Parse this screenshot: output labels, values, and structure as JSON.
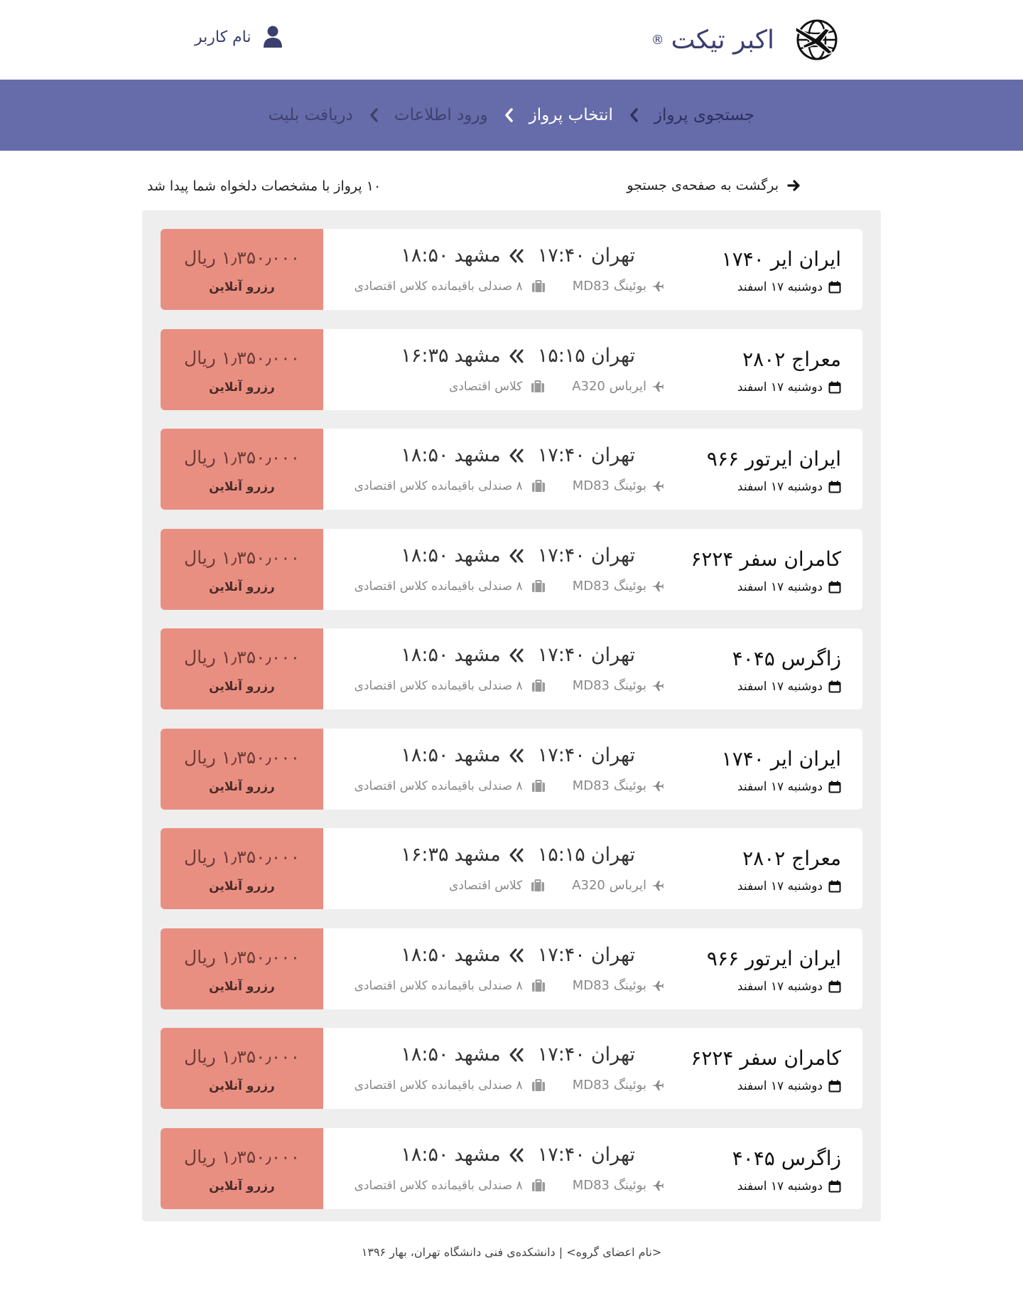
{
  "header": {
    "brand": "اکبر تیکت",
    "registered_mark": "®",
    "user_name": "نام کاربر",
    "logo_icon": "globe-plane-icon",
    "user_icon": "user-icon"
  },
  "steps": [
    {
      "label": "جستجوی پرواز",
      "state": "done"
    },
    {
      "label": "انتخاب پرواز",
      "state": "active"
    },
    {
      "label": "ورود اطلاعات",
      "state": "future"
    },
    {
      "label": "دریافت بلیت",
      "state": "future"
    }
  ],
  "results": {
    "back_label": "برگشت به صفحه‌ی جستجو",
    "count_label": "۱۰ پرواز با مشخصات  دلخواه شما پیدا شد"
  },
  "colors": {
    "steps_bar": "#666ba9",
    "price_box": "#e98f82",
    "list_bg": "#eeeeee",
    "brand_text": "#3b3f6e"
  },
  "flights": [
    {
      "airline": "ایران ایر ۱۷۴۰",
      "date": "دوشنبه ۱۷ اسفند",
      "origin": "تهران",
      "departure": "۱۷:۴۰",
      "destination": "مشهد",
      "arrival": "۱۸:۵۰",
      "aircraft": "بوئینگ MD83",
      "seats": "۸ صندلی باقیمانده کلاس اقتصادی",
      "price": "۱٫۳۵۰٫۰۰۰ ریال",
      "book": "رزرو آنلاین"
    },
    {
      "airline": "معراج ۲۸۰۲",
      "date": "دوشنبه ۱۷ اسفند",
      "origin": "تهران",
      "departure": "۱۵:۱۵",
      "destination": "مشهد",
      "arrival": "۱۶:۳۵",
      "aircraft": "ایرباس A320",
      "seats": "کلاس اقتصادی",
      "price": "۱٫۳۵۰٫۰۰۰ ریال",
      "book": "رزرو آنلاین"
    },
    {
      "airline": "ایران ایرتور ۹۶۶",
      "date": "دوشنبه ۱۷ اسفند",
      "origin": "تهران",
      "departure": "۱۷:۴۰",
      "destination": "مشهد",
      "arrival": "۱۸:۵۰",
      "aircraft": "بوئینگ MD83",
      "seats": "۸ صندلی باقیمانده کلاس اقتصادی",
      "price": "۱٫۳۵۰٫۰۰۰ ریال",
      "book": "رزرو آنلاین"
    },
    {
      "airline": "کامران سفر ۶۲۲۴",
      "date": "دوشنبه ۱۷ اسفند",
      "origin": "تهران",
      "departure": "۱۷:۴۰",
      "destination": "مشهد",
      "arrival": "۱۸:۵۰",
      "aircraft": "بوئینگ MD83",
      "seats": "۸ صندلی باقیمانده کلاس اقتصادی",
      "price": "۱٫۳۵۰٫۰۰۰ ریال",
      "book": "رزرو آنلاین"
    },
    {
      "airline": "زاگرس ۴۰۴۵",
      "date": "دوشنبه ۱۷ اسفند",
      "origin": "تهران",
      "departure": "۱۷:۴۰",
      "destination": "مشهد",
      "arrival": "۱۸:۵۰",
      "aircraft": "بوئینگ MD83",
      "seats": "۸ صندلی باقیمانده کلاس اقتصادی",
      "price": "۱٫۳۵۰٫۰۰۰ ریال",
      "book": "رزرو آنلاین"
    },
    {
      "airline": "ایران ایر ۱۷۴۰",
      "date": "دوشنبه ۱۷ اسفند",
      "origin": "تهران",
      "departure": "۱۷:۴۰",
      "destination": "مشهد",
      "arrival": "۱۸:۵۰",
      "aircraft": "بوئینگ MD83",
      "seats": "۸ صندلی باقیمانده کلاس اقتصادی",
      "price": "۱٫۳۵۰٫۰۰۰ ریال",
      "book": "رزرو آنلاین"
    },
    {
      "airline": "معراج ۲۸۰۲",
      "date": "دوشنبه ۱۷ اسفند",
      "origin": "تهران",
      "departure": "۱۵:۱۵",
      "destination": "مشهد",
      "arrival": "۱۶:۳۵",
      "aircraft": "ایرباس A320",
      "seats": "کلاس اقتصادی",
      "price": "۱٫۳۵۰٫۰۰۰ ریال",
      "book": "رزرو آنلاین"
    },
    {
      "airline": "ایران ایرتور ۹۶۶",
      "date": "دوشنبه ۱۷ اسفند",
      "origin": "تهران",
      "departure": "۱۷:۴۰",
      "destination": "مشهد",
      "arrival": "۱۸:۵۰",
      "aircraft": "بوئینگ MD83",
      "seats": "۸ صندلی باقیمانده کلاس اقتصادی",
      "price": "۱٫۳۵۰٫۰۰۰ ریال",
      "book": "رزرو آنلاین"
    },
    {
      "airline": "کامران سفر ۶۲۲۴",
      "date": "دوشنبه ۱۷ اسفند",
      "origin": "تهران",
      "departure": "۱۷:۴۰",
      "destination": "مشهد",
      "arrival": "۱۸:۵۰",
      "aircraft": "بوئینگ MD83",
      "seats": "۸ صندلی باقیمانده کلاس اقتصادی",
      "price": "۱٫۳۵۰٫۰۰۰ ریال",
      "book": "رزرو آنلاین"
    },
    {
      "airline": "زاگرس ۴۰۴۵",
      "date": "دوشنبه ۱۷ اسفند",
      "origin": "تهران",
      "departure": "۱۷:۴۰",
      "destination": "مشهد",
      "arrival": "۱۸:۵۰",
      "aircraft": "بوئینگ MD83",
      "seats": "۸ صندلی باقیمانده کلاس اقتصادی",
      "price": "۱٫۳۵۰٫۰۰۰ ریال",
      "book": "رزرو آنلاین"
    }
  ],
  "footer": {
    "text": "<نام اعضای گروه>  |  دانشکده‌ی فنی دانشگاه تهران، بهار ۱۳۹۶"
  }
}
